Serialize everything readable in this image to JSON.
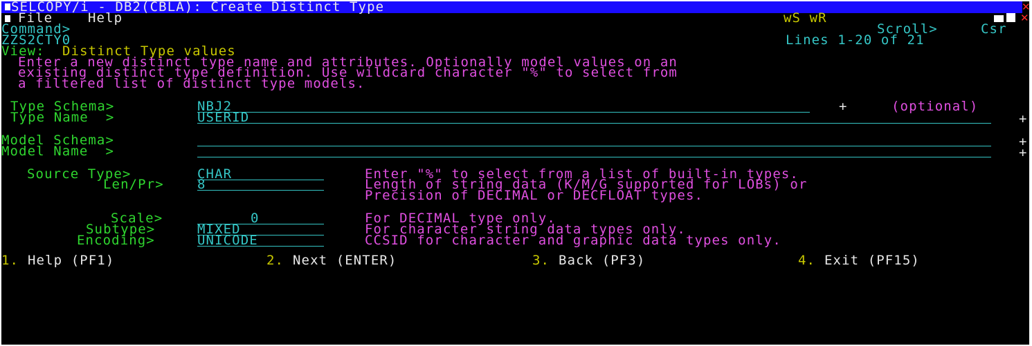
{
  "panel": {
    "title": "SELCOPY/i - DB2(CBLA): Create Distinct Type",
    "menu": {
      "file": "File",
      "help": "Help"
    },
    "ws_wr": "wS wR",
    "command_label": "Command>",
    "scroll_label": "Scroll>",
    "scroll_value": "Csr",
    "panel_id": "ZZS2CTY0",
    "lines_info": "Lines 1-20 of 21",
    "view_label": "View:",
    "view_name": "Distinct Type values",
    "instructions": [
      "Enter a new distinct type name and attributes. Optionally model values on an",
      "existing distinct type definition. Use wildcard character \"%\" to select from",
      "a filtered list of distinct type models."
    ]
  },
  "fields": {
    "type_schema": {
      "label": "Type Schema>",
      "value": "NBJ2",
      "prompt": "+",
      "note": "(optional)"
    },
    "type_name": {
      "label": "Type Name  >",
      "value": "USERID",
      "prompt": "+"
    },
    "model_schema": {
      "label": "Model Schema>",
      "value": "",
      "prompt": "+"
    },
    "model_name": {
      "label": "Model Name  >",
      "value": "",
      "prompt": "+"
    },
    "source_type": {
      "label": "Source Type>",
      "value": "CHAR",
      "help": "Enter \"%\" to select from a list of built-in types."
    },
    "len_pr": {
      "label": "Len/Pr>",
      "value": "8",
      "help1": "Length of string data (K/M/G supported for LOBs) or",
      "help2": "Precision of DECIMAL or DECFLOAT types."
    },
    "scale": {
      "label": "Scale>",
      "value": "0",
      "help": "For DECIMAL type only."
    },
    "subtype": {
      "label": "Subtype>",
      "value": "MIXED",
      "help": "For character string data types only."
    },
    "encoding": {
      "label": "Encoding>",
      "value": "UNICODE",
      "help": "CCSID for character and graphic data types only."
    }
  },
  "pfkeys": [
    {
      "num": "1.",
      "label": "Help (PF1)"
    },
    {
      "num": "2.",
      "label": "Next (ENTER)"
    },
    {
      "num": "3.",
      "label": "Back (PF3)"
    },
    {
      "num": "4.",
      "label": "Exit (PF15)"
    }
  ],
  "colors": {
    "title_bar": "#1a0cff",
    "cyan": "#35c6c6",
    "green": "#2fd62f",
    "yellow": "#c8c800",
    "magenta": "#e04fe0",
    "close": "#ff2a2a"
  }
}
